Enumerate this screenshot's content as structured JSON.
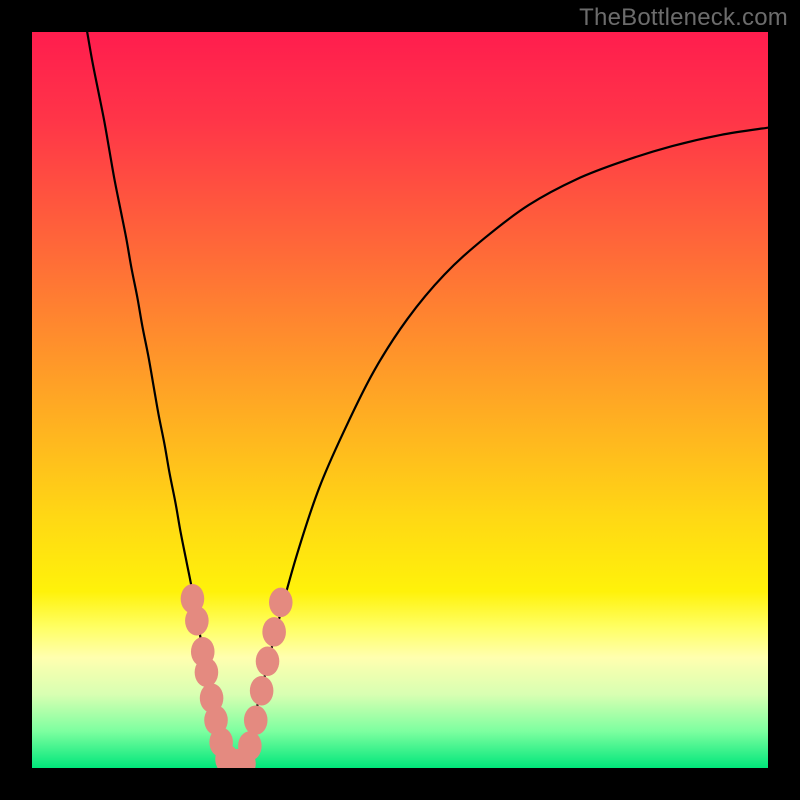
{
  "watermark": {
    "text": "TheBottleneck.com"
  },
  "chart_data": {
    "type": "line",
    "title": "",
    "xlabel": "",
    "ylabel": "",
    "xlim": [
      0,
      1
    ],
    "ylim": [
      0,
      1
    ],
    "grid": false,
    "gradient_stops": [
      {
        "offset": 0.0,
        "color": "#ff1d4e"
      },
      {
        "offset": 0.12,
        "color": "#ff3548"
      },
      {
        "offset": 0.3,
        "color": "#ff6a38"
      },
      {
        "offset": 0.48,
        "color": "#ffa126"
      },
      {
        "offset": 0.66,
        "color": "#ffd814"
      },
      {
        "offset": 0.76,
        "color": "#fff20a"
      },
      {
        "offset": 0.81,
        "color": "#ffff66"
      },
      {
        "offset": 0.85,
        "color": "#ffffaf"
      },
      {
        "offset": 0.9,
        "color": "#d8ffb2"
      },
      {
        "offset": 0.95,
        "color": "#7dffa0"
      },
      {
        "offset": 1.0,
        "color": "#00e67a"
      }
    ],
    "series": [
      {
        "name": "left-branch",
        "type": "line",
        "color": "#000000",
        "points": [
          {
            "x": 0.075,
            "y": 1.0
          },
          {
            "x": 0.082,
            "y": 0.96
          },
          {
            "x": 0.09,
            "y": 0.92
          },
          {
            "x": 0.098,
            "y": 0.88
          },
          {
            "x": 0.105,
            "y": 0.84
          },
          {
            "x": 0.112,
            "y": 0.8
          },
          {
            "x": 0.12,
            "y": 0.76
          },
          {
            "x": 0.128,
            "y": 0.72
          },
          {
            "x": 0.135,
            "y": 0.68
          },
          {
            "x": 0.143,
            "y": 0.64
          },
          {
            "x": 0.15,
            "y": 0.6
          },
          {
            "x": 0.158,
            "y": 0.56
          },
          {
            "x": 0.165,
            "y": 0.52
          },
          {
            "x": 0.172,
            "y": 0.48
          },
          {
            "x": 0.18,
            "y": 0.44
          },
          {
            "x": 0.187,
            "y": 0.4
          },
          {
            "x": 0.195,
            "y": 0.36
          },
          {
            "x": 0.202,
            "y": 0.32
          },
          {
            "x": 0.21,
            "y": 0.28
          },
          {
            "x": 0.218,
            "y": 0.24
          },
          {
            "x": 0.225,
            "y": 0.2
          },
          {
            "x": 0.232,
            "y": 0.16
          },
          {
            "x": 0.24,
            "y": 0.12
          },
          {
            "x": 0.248,
            "y": 0.08
          },
          {
            "x": 0.255,
            "y": 0.045
          },
          {
            "x": 0.262,
            "y": 0.02
          },
          {
            "x": 0.27,
            "y": 0.005
          },
          {
            "x": 0.278,
            "y": 0.0
          }
        ]
      },
      {
        "name": "right-branch",
        "type": "line",
        "color": "#000000",
        "points": [
          {
            "x": 0.278,
            "y": 0.0
          },
          {
            "x": 0.29,
            "y": 0.02
          },
          {
            "x": 0.3,
            "y": 0.06
          },
          {
            "x": 0.315,
            "y": 0.12
          },
          {
            "x": 0.335,
            "y": 0.2
          },
          {
            "x": 0.36,
            "y": 0.29
          },
          {
            "x": 0.39,
            "y": 0.38
          },
          {
            "x": 0.425,
            "y": 0.46
          },
          {
            "x": 0.465,
            "y": 0.54
          },
          {
            "x": 0.51,
            "y": 0.61
          },
          {
            "x": 0.56,
            "y": 0.67
          },
          {
            "x": 0.615,
            "y": 0.72
          },
          {
            "x": 0.675,
            "y": 0.765
          },
          {
            "x": 0.74,
            "y": 0.8
          },
          {
            "x": 0.805,
            "y": 0.825
          },
          {
            "x": 0.87,
            "y": 0.845
          },
          {
            "x": 0.935,
            "y": 0.86
          },
          {
            "x": 1.0,
            "y": 0.87
          }
        ]
      }
    ],
    "markers": {
      "color": "#e48a80",
      "radius_norm": 0.016,
      "points": [
        {
          "x": 0.218,
          "y": 0.23
        },
        {
          "x": 0.224,
          "y": 0.2
        },
        {
          "x": 0.232,
          "y": 0.158
        },
        {
          "x": 0.237,
          "y": 0.13
        },
        {
          "x": 0.244,
          "y": 0.095
        },
        {
          "x": 0.25,
          "y": 0.065
        },
        {
          "x": 0.257,
          "y": 0.035
        },
        {
          "x": 0.265,
          "y": 0.012
        },
        {
          "x": 0.272,
          "y": 0.006
        },
        {
          "x": 0.28,
          "y": 0.006
        },
        {
          "x": 0.288,
          "y": 0.006
        },
        {
          "x": 0.296,
          "y": 0.03
        },
        {
          "x": 0.304,
          "y": 0.065
        },
        {
          "x": 0.312,
          "y": 0.105
        },
        {
          "x": 0.32,
          "y": 0.145
        },
        {
          "x": 0.329,
          "y": 0.185
        },
        {
          "x": 0.338,
          "y": 0.225
        }
      ]
    }
  }
}
